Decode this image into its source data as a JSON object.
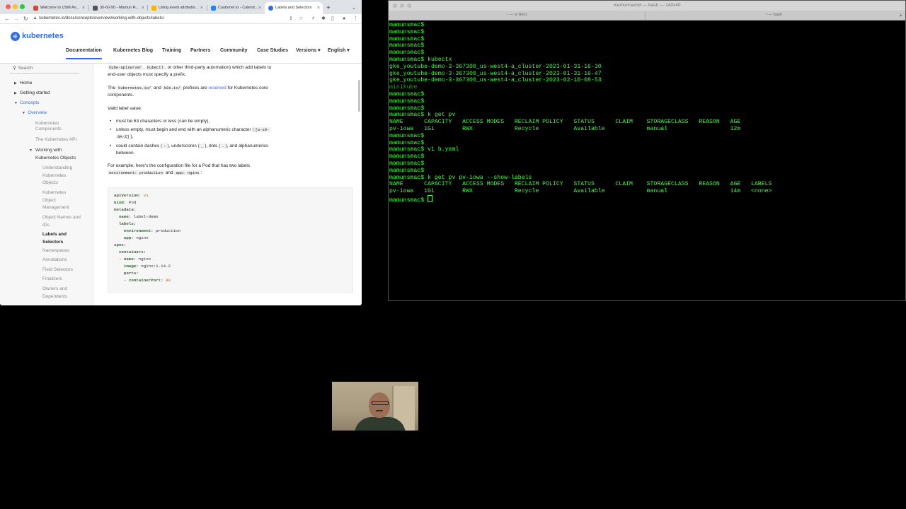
{
  "browser": {
    "tabs": [
      {
        "label": "Welcome to USM An...",
        "icon": "gmail-icon",
        "color": "#d44638"
      },
      {
        "label": "30-60-90 - Mamun R...",
        "icon": "doc-icon",
        "color": "#555555"
      },
      {
        "label": "Using event attributio...",
        "icon": "page-icon",
        "color": "#f4b400"
      },
      {
        "label": "Customer.io - Calend...",
        "icon": "calendar-icon",
        "color": "#2d7ff9"
      },
      {
        "label": "Labels and Selectors",
        "icon": "k8s-icon",
        "color": "#326ce5"
      }
    ],
    "url": "kubernetes.io/docs/concepts/overview/working-with-objects/labels/"
  },
  "site": {
    "logo_text": "kubernetes",
    "nav": [
      "Documentation",
      "Kubernetes Blog",
      "Training",
      "Partners",
      "Community",
      "Case Studies",
      "Versions ▾",
      "English ▾"
    ]
  },
  "sidebar": {
    "search_placeholder": "Search",
    "items": [
      "Home",
      "Getting started",
      "Concepts",
      "Overview",
      "Kubernetes",
      "Components",
      "The Kubernetes API",
      "Working with",
      "Kubernetes Objects",
      "Understanding",
      "Kubernetes",
      "Objects",
      "Kubernetes",
      "Object",
      "Management",
      "Object Names and",
      "IDs",
      "Labels and",
      "Selectors",
      "Namespaces",
      "Annotations",
      "Field Selectors",
      "Finalizers",
      "Owners and",
      "Dependents"
    ]
  },
  "content": {
    "p1_code1": "kube-apiserver",
    "p1_comma": ",",
    "p1_code2": "kubectl",
    "p1_rest": ", or other third-party automation) which add labels to",
    "p1_line2": "end-user objects must specify a prefix.",
    "p2_the": "The",
    "p2_code1": "kubernetes.io/",
    "p2_and": "and",
    "p2_code2": "k8s.io/",
    "p2_mid": "prefixes are",
    "p2_link": "reserved",
    "p2_end": "for Kubernetes core",
    "p2_line2": "components.",
    "p3": "Valid label value:",
    "b1": "must be 63 characters or less (can be empty),",
    "b2_a": "unless empty, must begin and end with an alphanumeric character (",
    "b2_code1": "[a-z0-",
    "b2_code2": "9A-Z]",
    "b2_b": "),",
    "b3_a": "could contain dashes (",
    "b3_c1": "-",
    "b3_b": "), underscores (",
    "b3_c2": "_",
    "b3_c": "), dots (",
    "b3_c3": ".",
    "b3_d": "), and alphanumerics",
    "b3_line2": "between.",
    "p4": "For example, here's the configuration file for a Pod that has two labels",
    "p4_code1": "environment: production",
    "p4_and": "and",
    "p4_code2": "app: nginx",
    "p4_colon": ":",
    "yaml": [
      [
        "apiVersion:",
        " v1"
      ],
      [
        "kind:",
        " Pod"
      ],
      [
        "metadata:",
        ""
      ],
      [
        "  name:",
        " label-demo"
      ],
      [
        "  labels:",
        ""
      ],
      [
        "    environment:",
        " production"
      ],
      [
        "    app:",
        " nginx"
      ],
      [
        "spec:",
        ""
      ],
      [
        "  containers:",
        ""
      ],
      [
        "  - name:",
        " nginx"
      ],
      [
        "    image:",
        " nginx:1.14.2"
      ],
      [
        "    ports:",
        ""
      ],
      [
        "    - containerPort:",
        " 80"
      ]
    ]
  },
  "terminal": {
    "title": "mamunrashid — bash — 140x40",
    "tab1": "~ — vi REO",
    "tab2": "~ — bash",
    "lines": [
      "mamunsmac$",
      "mamunsmac$",
      "mamunsmac$",
      "mamunsmac$",
      "mamunsmac$",
      "mamunsmac$ kubectx",
      "gke_youtube-demo-3-367300_us-west4-a_cluster-2023-01-31-16-30",
      "gke_youtube-demo-3-367300_us-west4-a_cluster-2023-01-31-16-47",
      "gke_youtube-demo-3-367300_us-west4-a_cluster-2023-02-10-08-53",
      "minikube",
      "mamunsmac$",
      "mamunsmac$",
      "mamunsmac$",
      "mamunsmac$ k get pv",
      "NAME      CAPACITY   ACCESS MODES   RECLAIM POLICY   STATUS      CLAIM    STORAGECLASS   REASON   AGE",
      "pv-iowa   1Gi        RWX            Recycle          Available            manual                  12m",
      "mamunsmac$",
      "mamunsmac$",
      "mamunsmac$ vi b.yaml",
      "mamunsmac$",
      "mamunsmac$",
      "mamunsmac$",
      "mamunsmac$ k get pv pv-iowa --show-labels",
      "NAME      CAPACITY   ACCESS MODES   RECLAIM POLICY   STATUS      CLAIM    STORAGECLASS   REASON   AGE   LABELS",
      "pv-iowa   1Gi        RWX            Recycle          Available            manual                  14m   <none>",
      "mamunsmac$ "
    ]
  }
}
